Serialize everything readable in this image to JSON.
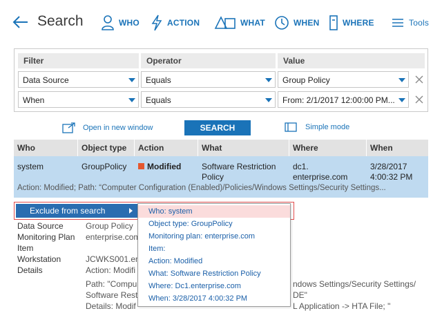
{
  "header": {
    "title": "Search",
    "nav": [
      {
        "label": "WHO",
        "icon": "person-icon"
      },
      {
        "label": "ACTION",
        "icon": "lightning-icon"
      },
      {
        "label": "WHAT",
        "icon": "shapes-icon"
      },
      {
        "label": "WHEN",
        "icon": "clock-icon"
      },
      {
        "label": "WHERE",
        "icon": "building-icon"
      }
    ],
    "tools_label": "Tools"
  },
  "filters": {
    "headers": {
      "filter": "Filter",
      "operator": "Operator",
      "value": "Value"
    },
    "rows": [
      {
        "filter": "Data Source",
        "operator": "Equals",
        "value": "Group Policy"
      },
      {
        "filter": "When",
        "operator": "Equals",
        "value": "From: 2/1/2017 12:00:00 PM..."
      }
    ]
  },
  "actions": {
    "open_new_window": "Open in new window",
    "search": "SEARCH",
    "simple_mode": "Simple mode"
  },
  "results": {
    "columns": [
      "Who",
      "Object type",
      "Action",
      "What",
      "Where",
      "When"
    ],
    "row": {
      "who": "system",
      "object_type": "GroupPolicy",
      "action": "Modified",
      "what_1": "Software Restriction",
      "what_2": "Policy",
      "where_1": "dc1.",
      "where_2": "enterprise.com",
      "when_1": "3/28/2017",
      "when_2": "4:00:32 PM",
      "details": "Action: Modified; Path: “Computer Configuration (Enabled)/Policies/Windows Settings/Security Settings..."
    },
    "action_color": "#e4572e"
  },
  "detail": {
    "labels": [
      "Data Source",
      "Monitoring Plan",
      "Item",
      "Workstation",
      "Details"
    ],
    "values": {
      "data_source": "Group Policy",
      "monitoring_plan": "enterprise.com",
      "workstation": "JCWKS001.ent",
      "details_1": "Action: Modifi",
      "details_2": "Path: \"Compu",
      "details_2b": "ndows Settings/Security Settings/",
      "details_3": "Software Restri",
      "details_3b": "DE\"",
      "details_4": "Details: Modif",
      "details_4b": "L Application -> HTA File; \""
    }
  },
  "context_menu": {
    "main_label": "Exclude from search",
    "items": [
      "Who: system",
      "Object type: GroupPolicy",
      "Monitoring plan: enterprise.com",
      "Item:",
      "Action: Modified",
      "What: Software Restriction Policy",
      "Where: Dc1.enterprise.com",
      "When: 3/28/2017 4:00:32 PM"
    ]
  }
}
